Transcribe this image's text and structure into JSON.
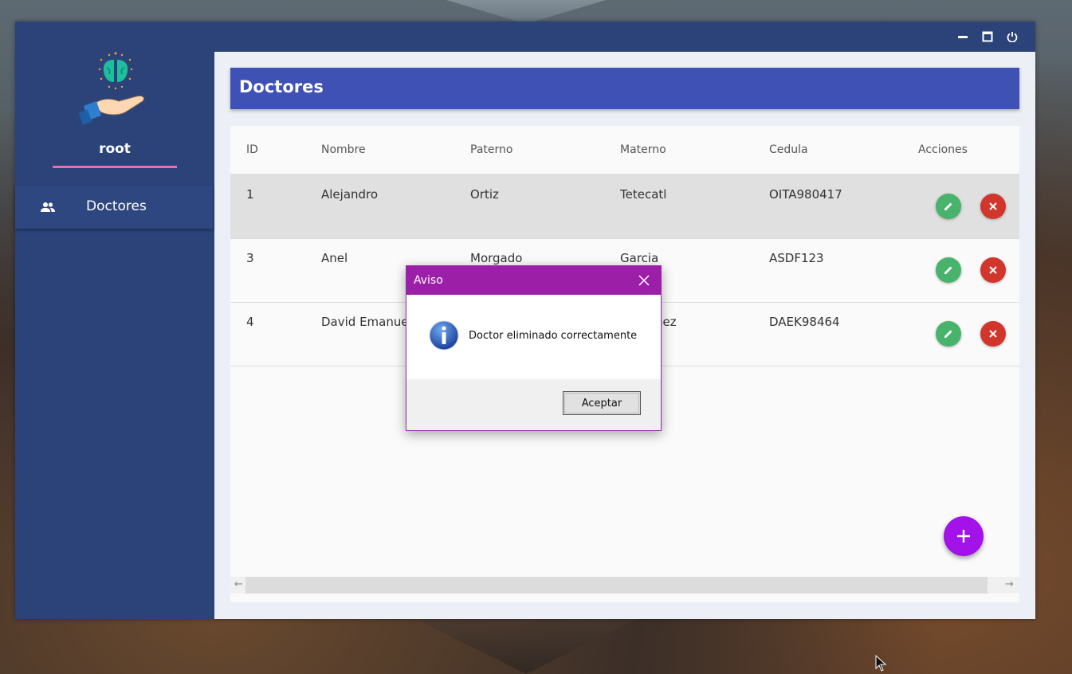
{
  "window": {
    "controls": [
      "minimize",
      "maximize",
      "power"
    ]
  },
  "sidebar": {
    "username": "root",
    "nav": [
      {
        "label": "Doctores",
        "icon": "people-icon"
      }
    ]
  },
  "header": {
    "title": "Doctores"
  },
  "table": {
    "columns": [
      "ID",
      "Nombre",
      "Paterno",
      "Materno",
      "Cedula",
      "Acciones"
    ],
    "rows": [
      {
        "id": "1",
        "nombre": "Alejandro",
        "paterno": "Ortiz",
        "materno": "Tetecatl",
        "cedula": "OITA980417"
      },
      {
        "id": "3",
        "nombre": "Anel",
        "paterno": "Morgado",
        "materno": "Garcia",
        "cedula": "ASDF123"
      },
      {
        "id": "4",
        "nombre": "David Emanuel",
        "paterno": "",
        "materno": "uez",
        "cedula": "DAEK98464"
      }
    ]
  },
  "dialog": {
    "title": "Aviso",
    "message": "Doctor eliminado correctamente",
    "ok_label": "Aceptar"
  },
  "colors": {
    "sidebar": "#2b4379",
    "header": "#3f51b5",
    "edit": "#47b36b",
    "delete": "#d0362b",
    "fab": "#a312e8",
    "dialog_title": "#9c1fa7",
    "underline": "#e66fb0"
  }
}
